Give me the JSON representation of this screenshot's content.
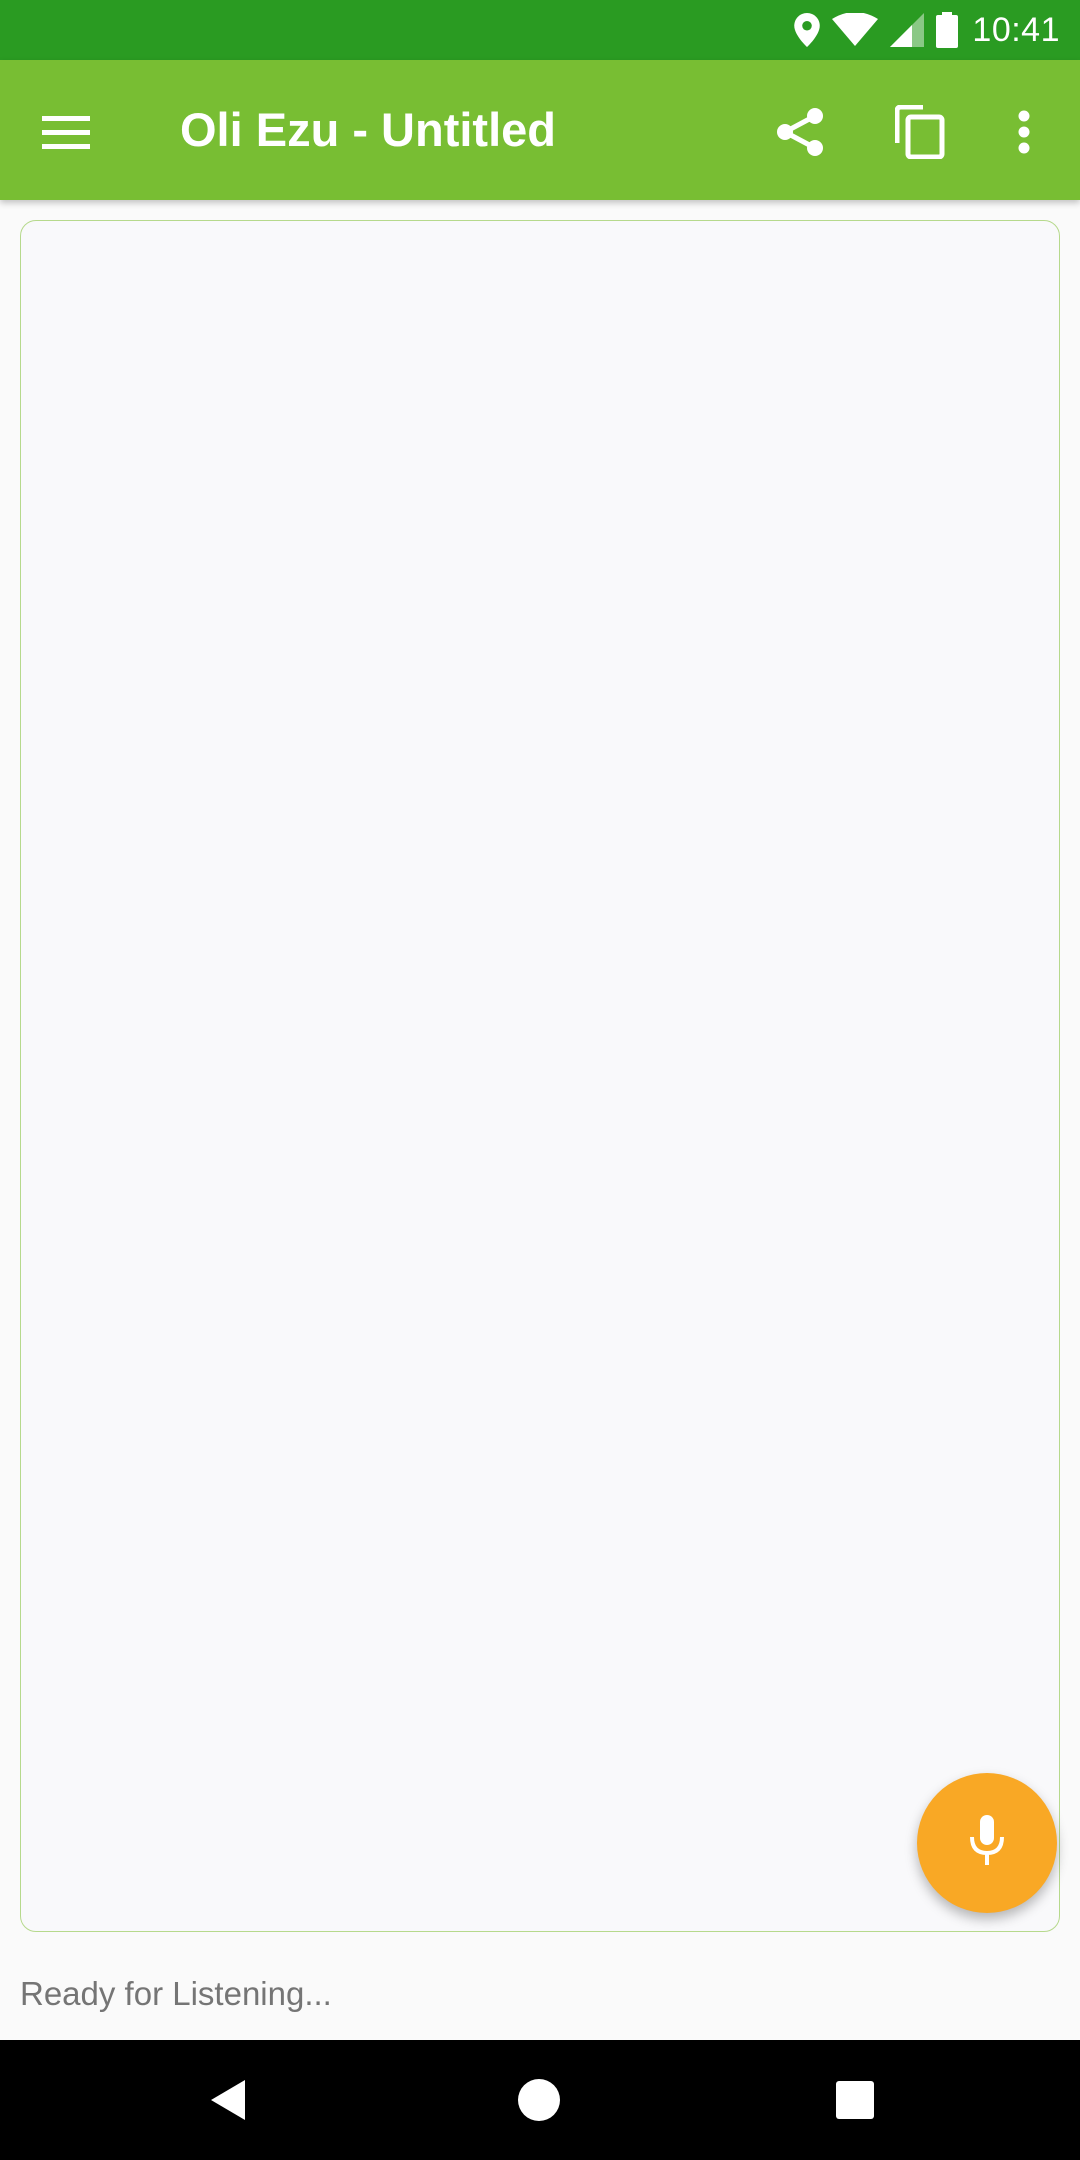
{
  "status_bar": {
    "time": "10:41",
    "icons": [
      "location-icon",
      "wifi-icon",
      "cellular-signal-icon",
      "battery-icon"
    ]
  },
  "app_bar": {
    "title": "Oli Ezu - Untitled",
    "menu_icon": "hamburger-menu-icon",
    "actions": [
      "share-icon",
      "copy-icon",
      "more-vert-icon"
    ]
  },
  "editor": {
    "content": ""
  },
  "fab": {
    "icon": "microphone-icon"
  },
  "status_message": "Ready for Listening...",
  "nav_bar": {
    "buttons": [
      "back-icon",
      "home-icon",
      "recents-icon"
    ]
  },
  "colors": {
    "status_bar": "#2a9b22",
    "app_bar": "#78be33",
    "fab": "#f9a825",
    "border": "#b6d98c"
  }
}
